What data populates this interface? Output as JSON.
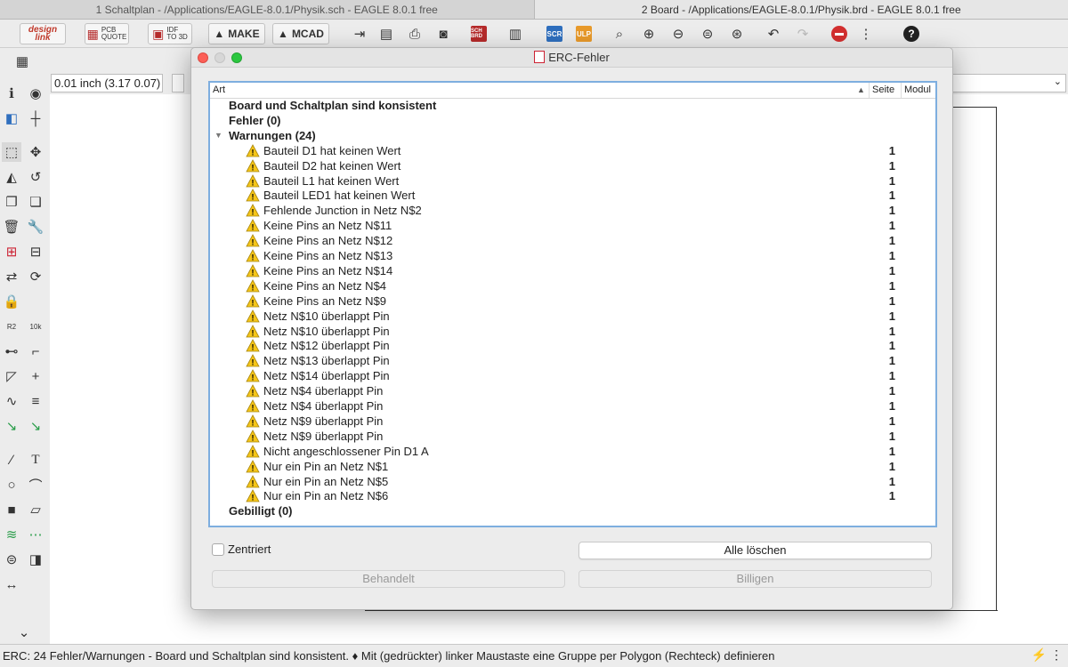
{
  "window_tabs": [
    "1 Schaltplan - /Applications/EAGLE-8.0.1/Physik.sch - EAGLE 8.0.1 free",
    "2 Board - /Applications/EAGLE-8.0.1/Physik.brd - EAGLE 8.0.1 free"
  ],
  "toolbar": {
    "designlink_line1": "design",
    "designlink_line2": "link",
    "pcbquote_line1": "PCB",
    "pcbquote_line2": "QUOTE",
    "idf_line1": "IDF",
    "idf_line2": "TO 3D",
    "make_label": "MAKE",
    "mcad_label": "MCAD",
    "sch_label": "SCH BRD",
    "scr_label": "SCR",
    "ulp_label": "ULP"
  },
  "coordinate": "0.01 inch (3.17 0.07)",
  "dialog": {
    "title": "ERC-Fehler",
    "columns": {
      "art": "Art",
      "seite": "Seite",
      "modul": "Modul"
    },
    "consistent_text": "Board und Schaltplan sind konsistent",
    "errors_group": "Fehler (0)",
    "warnings_group": "Warnungen (24)",
    "approved_group": "Gebilligt (0)",
    "warnings": [
      {
        "text": "Bauteil D1 hat keinen Wert",
        "page": "1"
      },
      {
        "text": "Bauteil D2 hat keinen Wert",
        "page": "1"
      },
      {
        "text": "Bauteil L1 hat keinen Wert",
        "page": "1"
      },
      {
        "text": "Bauteil LED1 hat keinen Wert",
        "page": "1"
      },
      {
        "text": "Fehlende Junction in Netz N$2",
        "page": "1"
      },
      {
        "text": "Keine Pins an Netz N$11",
        "page": "1"
      },
      {
        "text": "Keine Pins an Netz N$12",
        "page": "1"
      },
      {
        "text": "Keine Pins an Netz N$13",
        "page": "1"
      },
      {
        "text": "Keine Pins an Netz N$14",
        "page": "1"
      },
      {
        "text": "Keine Pins an Netz N$4",
        "page": "1"
      },
      {
        "text": "Keine Pins an Netz N$9",
        "page": "1"
      },
      {
        "text": "Netz N$10 überlappt Pin",
        "page": "1"
      },
      {
        "text": "Netz N$10 überlappt Pin",
        "page": "1"
      },
      {
        "text": "Netz N$12 überlappt Pin",
        "page": "1"
      },
      {
        "text": "Netz N$13 überlappt Pin",
        "page": "1"
      },
      {
        "text": "Netz N$14 überlappt Pin",
        "page": "1"
      },
      {
        "text": "Netz N$4 überlappt Pin",
        "page": "1"
      },
      {
        "text": "Netz N$4 überlappt Pin",
        "page": "1"
      },
      {
        "text": "Netz N$9 überlappt Pin",
        "page": "1"
      },
      {
        "text": "Netz N$9 überlappt Pin",
        "page": "1"
      },
      {
        "text": "Nicht angeschlossener Pin D1 A",
        "page": "1"
      },
      {
        "text": "Nur ein Pin an Netz N$1",
        "page": "1"
      },
      {
        "text": "Nur ein Pin an Netz N$5",
        "page": "1"
      },
      {
        "text": "Nur ein Pin an Netz N$6",
        "page": "1"
      }
    ],
    "centered_label": "Zentriert",
    "clear_all_label": "Alle löschen",
    "handled_label": "Behandelt",
    "approve_label": "Billigen"
  },
  "status_text": "ERC: 24 Fehler/Warnungen - Board und Schaltplan sind konsistent.  ♦ Mit (gedrückter) linker Maustaste eine Gruppe per Polygon (Rechteck) definieren",
  "colors": {
    "focus_ring": "#7eaedf",
    "warning": "#f5c518",
    "close": "#fc5f57",
    "maximize": "#2bc740"
  }
}
